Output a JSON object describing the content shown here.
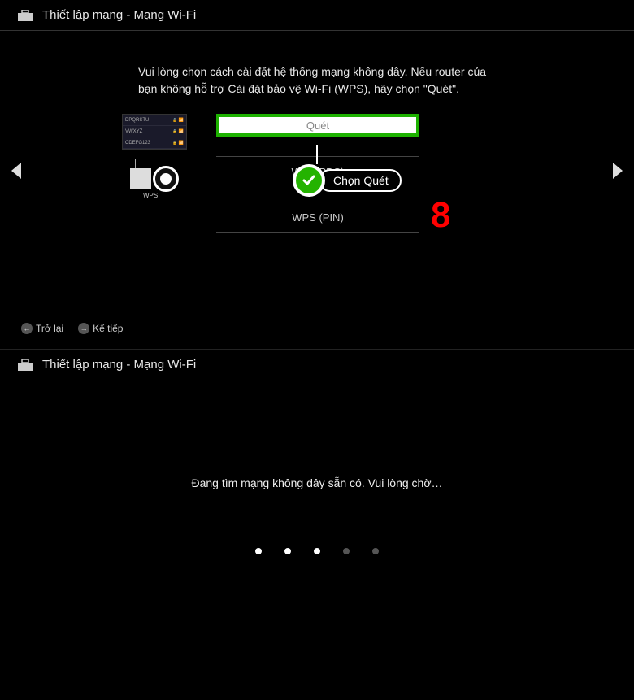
{
  "screen1": {
    "title": "Thiết lập mạng - Mạng Wi-Fi",
    "instruction": "Vui lòng chọn cách cài đặt hệ thống mạng không dây. Nếu router của bạn không hỗ trợ Cài đặt bảo vệ Wi-Fi (WPS), hãy chọn \"Quét\".",
    "networks": [
      "DPQRSTU",
      "VWXYZ",
      "CDEFG123"
    ],
    "scan_label": "Quét",
    "wps_label": "WPS",
    "option_wps_pbc": "WPS(PBC)",
    "option_wps_pin": "WPS (PIN)",
    "callout_text": "Chọn Quét",
    "step_number": "8",
    "back_label": "Trở lại",
    "next_label": "Kế tiếp"
  },
  "screen2": {
    "title": "Thiết lập mạng - Mạng Wi-Fi",
    "searching_text": "Đang tìm mạng không dây sẵn có. Vui lòng chờ…"
  }
}
